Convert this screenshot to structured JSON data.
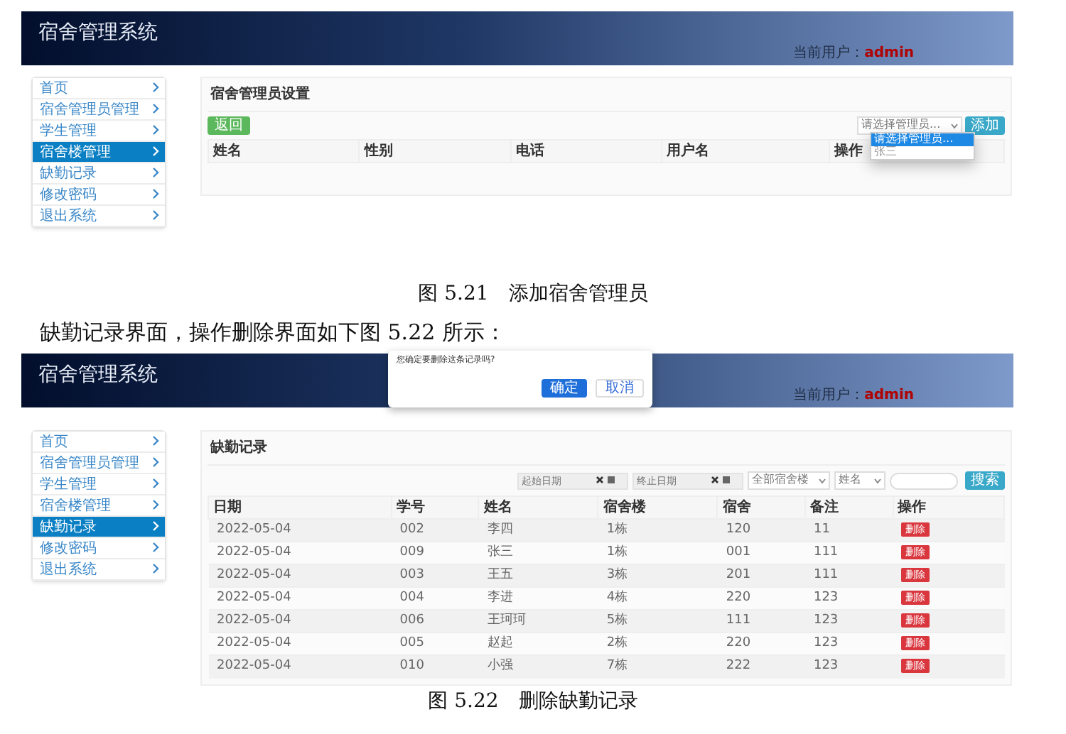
{
  "figure_1": {
    "app_title": "宿舍管理系统",
    "user_label": "当前用户：",
    "user_name": "admin",
    "sidebar": [
      {
        "label": "首页",
        "selected": false
      },
      {
        "label": "宿舍管理员管理",
        "selected": false
      },
      {
        "label": "学生管理",
        "selected": false
      },
      {
        "label": "宿舍楼管理",
        "selected": true
      },
      {
        "label": "缺勤记录",
        "selected": false
      },
      {
        "label": "修改密码",
        "selected": false
      },
      {
        "label": "退出系统",
        "selected": false
      }
    ],
    "panel": {
      "title": "宿舍管理员设置",
      "back_button": "返回",
      "select_value": "请选择管理员...",
      "select_options": [
        {
          "label": "请选择管理员...",
          "selected": true
        },
        {
          "label": "张三",
          "selected": false
        }
      ],
      "add_button": "添加",
      "columns": [
        "姓名",
        "性别",
        "电话",
        "用户名",
        "操作"
      ]
    },
    "caption": "图 5.21　添加宿舍管理员"
  },
  "paragraph": "缺勤记录界面，操作删除界面如下图 5.22 所示：",
  "figure_2": {
    "app_title": "宿舍管理系统",
    "user_label": "当前用户：",
    "user_name": "admin",
    "dialog": {
      "message": "您确定要删除这条记录吗?",
      "confirm_button": "确定",
      "cancel_button": "取消"
    },
    "sidebar": [
      {
        "label": "首页",
        "selected": false
      },
      {
        "label": "宿舍管理员管理",
        "selected": false
      },
      {
        "label": "学生管理",
        "selected": false
      },
      {
        "label": "宿舍楼管理",
        "selected": false
      },
      {
        "label": "缺勤记录",
        "selected": true
      },
      {
        "label": "修改密码",
        "selected": false
      },
      {
        "label": "退出系统",
        "selected": false
      }
    ],
    "panel": {
      "title": "缺勤记录",
      "start_date_placeholder": "起始日期",
      "end_date_placeholder": "终止日期",
      "building_select": "全部宿舍楼",
      "field_select": "姓名",
      "search_button": "搜索",
      "columns": [
        "日期",
        "学号",
        "姓名",
        "宿舍楼",
        "宿舍",
        "备注",
        "操作"
      ],
      "rows": [
        {
          "cells": [
            "2022-05-04",
            "002",
            "李四",
            "1栋",
            "120",
            "11"
          ],
          "action": "删除"
        },
        {
          "cells": [
            "2022-05-04",
            "009",
            "张三",
            "1栋",
            "001",
            "111"
          ],
          "action": "删除"
        },
        {
          "cells": [
            "2022-05-04",
            "003",
            "王五",
            "3栋",
            "201",
            "111"
          ],
          "action": "删除"
        },
        {
          "cells": [
            "2022-05-04",
            "004",
            "李进",
            "4栋",
            "220",
            "123"
          ],
          "action": "删除"
        },
        {
          "cells": [
            "2022-05-04",
            "006",
            "王珂珂",
            "5栋",
            "111",
            "123"
          ],
          "action": "删除"
        },
        {
          "cells": [
            "2022-05-04",
            "005",
            "赵起",
            "2栋",
            "220",
            "123"
          ],
          "action": "删除"
        },
        {
          "cells": [
            "2022-05-04",
            "010",
            "小强",
            "7栋",
            "222",
            "123"
          ],
          "action": "删除"
        }
      ]
    },
    "caption": "图 5.22　删除缺勤记录"
  }
}
